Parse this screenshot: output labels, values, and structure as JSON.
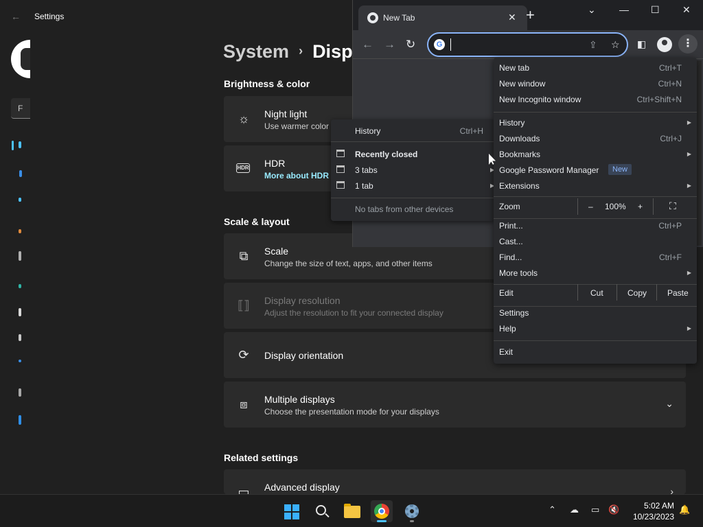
{
  "settings": {
    "app_title": "Settings",
    "search_initial": "F",
    "breadcrumb": {
      "parent": "System",
      "separator": "›",
      "current": "Disp"
    },
    "sections": {
      "brightness": "Brightness & color",
      "scale_layout": "Scale & layout",
      "related": "Related settings"
    },
    "cards": {
      "night_light": {
        "title": "Night light",
        "subtitle": "Use warmer color"
      },
      "hdr": {
        "title": "HDR",
        "link": "More about HDR"
      },
      "scale": {
        "title": "Scale",
        "subtitle": "Change the size of text, apps, and other items"
      },
      "resolution": {
        "title": "Display resolution",
        "subtitle": "Adjust the resolution to fit your connected display"
      },
      "orientation": {
        "title": "Display orientation"
      },
      "multiple": {
        "title": "Multiple displays",
        "subtitle": "Choose the presentation mode for your displays"
      },
      "advanced": {
        "title": "Advanced display"
      }
    },
    "accent_color": "#4cc2ff"
  },
  "chrome": {
    "tab_title": "New Tab",
    "omnibox_value": "",
    "history_submenu": {
      "history": {
        "label": "History",
        "shortcut": "Ctrl+H"
      },
      "recently_closed": "Recently closed",
      "items": [
        {
          "label": "3 tabs"
        },
        {
          "label": "1 tab"
        }
      ],
      "no_tabs": "No tabs from other devices"
    },
    "menu": {
      "new_tab": {
        "label": "New tab",
        "shortcut": "Ctrl+T"
      },
      "new_window": {
        "label": "New window",
        "shortcut": "Ctrl+N"
      },
      "new_incognito": {
        "label": "New Incognito window",
        "shortcut": "Ctrl+Shift+N"
      },
      "history": {
        "label": "History"
      },
      "downloads": {
        "label": "Downloads",
        "shortcut": "Ctrl+J"
      },
      "bookmarks": {
        "label": "Bookmarks"
      },
      "password_manager": {
        "label": "Google Password Manager",
        "badge": "New"
      },
      "extensions": {
        "label": "Extensions"
      },
      "zoom": {
        "label": "Zoom",
        "minus": "–",
        "value": "100%",
        "plus": "+"
      },
      "print": {
        "label": "Print...",
        "shortcut": "Ctrl+P"
      },
      "cast": {
        "label": "Cast..."
      },
      "find": {
        "label": "Find...",
        "shortcut": "Ctrl+F"
      },
      "more_tools": {
        "label": "More tools"
      },
      "edit": {
        "label": "Edit",
        "cut": "Cut",
        "copy": "Copy",
        "paste": "Paste"
      },
      "settings": {
        "label": "Settings"
      },
      "help": {
        "label": "Help"
      },
      "exit": {
        "label": "Exit"
      }
    },
    "accent_color": "#8ab4f8"
  },
  "taskbar": {
    "time": "5:02 AM",
    "date": "10/23/2023",
    "apps": [
      "start",
      "search",
      "file-explorer",
      "chrome",
      "settings"
    ]
  }
}
